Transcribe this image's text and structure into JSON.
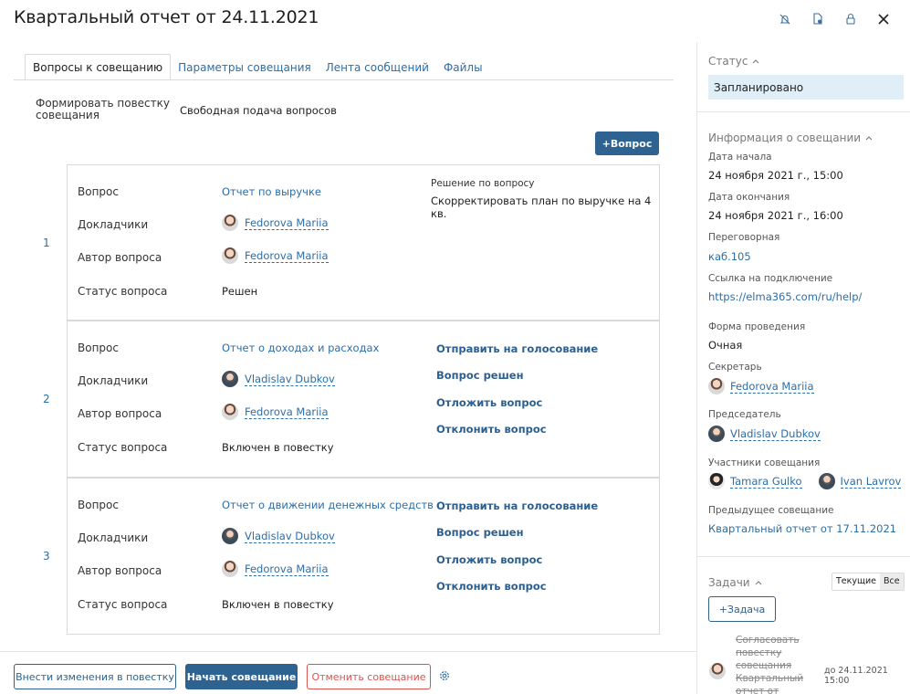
{
  "title": "Квартальный отчет от 24.11.2021",
  "toolbar_icons": [
    "bell-off-icon",
    "document-settings-icon",
    "lock-icon",
    "close-icon"
  ],
  "tabs": [
    {
      "label": "Вопросы к совещанию"
    },
    {
      "label": "Параметры совещания"
    },
    {
      "label": "Лента сообщений"
    },
    {
      "label": "Файлы"
    }
  ],
  "agenda": {
    "label": "Формировать повестку совещания",
    "value": "Свободная подача вопросов"
  },
  "add_question_label": "+Вопрос",
  "row_labels": {
    "question": "Вопрос",
    "speakers": "Докладчики",
    "author": "Автор вопроса",
    "status": "Статус вопроса"
  },
  "questions": [
    {
      "num": "1",
      "title": "Отчет по выручке",
      "speaker": "Fedorova Mariia",
      "author": "Fedorova Mariia",
      "status": "Решен",
      "decision_title": "Решение по вопросу",
      "decision": "Скорректировать план по выручке на 4 кв."
    },
    {
      "num": "2",
      "title": "Отчет о доходах и расходах",
      "speaker": "Vladislav Dubkov",
      "author": "Fedorova Mariia",
      "status": "Включен в повестку",
      "actions": [
        "Отправить на голосование",
        "Вопрос решен",
        "Отложить вопрос",
        "Отклонить вопрос"
      ]
    },
    {
      "num": "3",
      "title": "Отчет о движении денежных средств",
      "speaker": "Vladislav Dubkov",
      "author": "Fedorova Mariia",
      "status": "Включен в повестку",
      "actions": [
        "Отправить на голосование",
        "Вопрос решен",
        "Отложить вопрос",
        "Отклонить вопрос"
      ]
    }
  ],
  "footer": {
    "edit_agenda": "Внести изменения в повестку",
    "start": "Начать совещание",
    "cancel": "Отменить совещание"
  },
  "sidebar": {
    "status_title": "Статус",
    "status_value": "Запланировано",
    "info_title": "Информация о совещании",
    "start_label": "Дата начала",
    "start_value": "24 ноября 2021 г., 15:00",
    "end_label": "Дата окончания",
    "end_value": "24 ноября 2021 г., 16:00",
    "room_label": "Переговорная",
    "room_value": "каб.105",
    "link_label": "Ссылка на подключение",
    "link_value": "https://elma365.com/ru/help/",
    "format_label": "Форма проведения",
    "format_value": "Очная",
    "secretary_label": "Секретарь",
    "secretary_value": "Fedorova Mariia",
    "chair_label": "Председатель",
    "chair_value": "Vladislav Dubkov",
    "participants_label": "Участники совещания",
    "participants": [
      "Tamara Gulko",
      "Ivan Lavrov"
    ],
    "previous_label": "Предыдущее совещание",
    "previous_value": "Квартальный отчет от 17.11.2021",
    "tasks_title": "Задачи",
    "tasks_filter": [
      "Текущие",
      "Все"
    ],
    "add_task": "Задача",
    "task_text": "Согласовать повестку совещания Квартальный отчет от",
    "task_due": "до 24.11.2021 15:00"
  },
  "colors": {
    "primary": "#2d6291",
    "link": "#2c6ea8",
    "danger": "#d9534f",
    "status_bg": "#dfeef7"
  }
}
